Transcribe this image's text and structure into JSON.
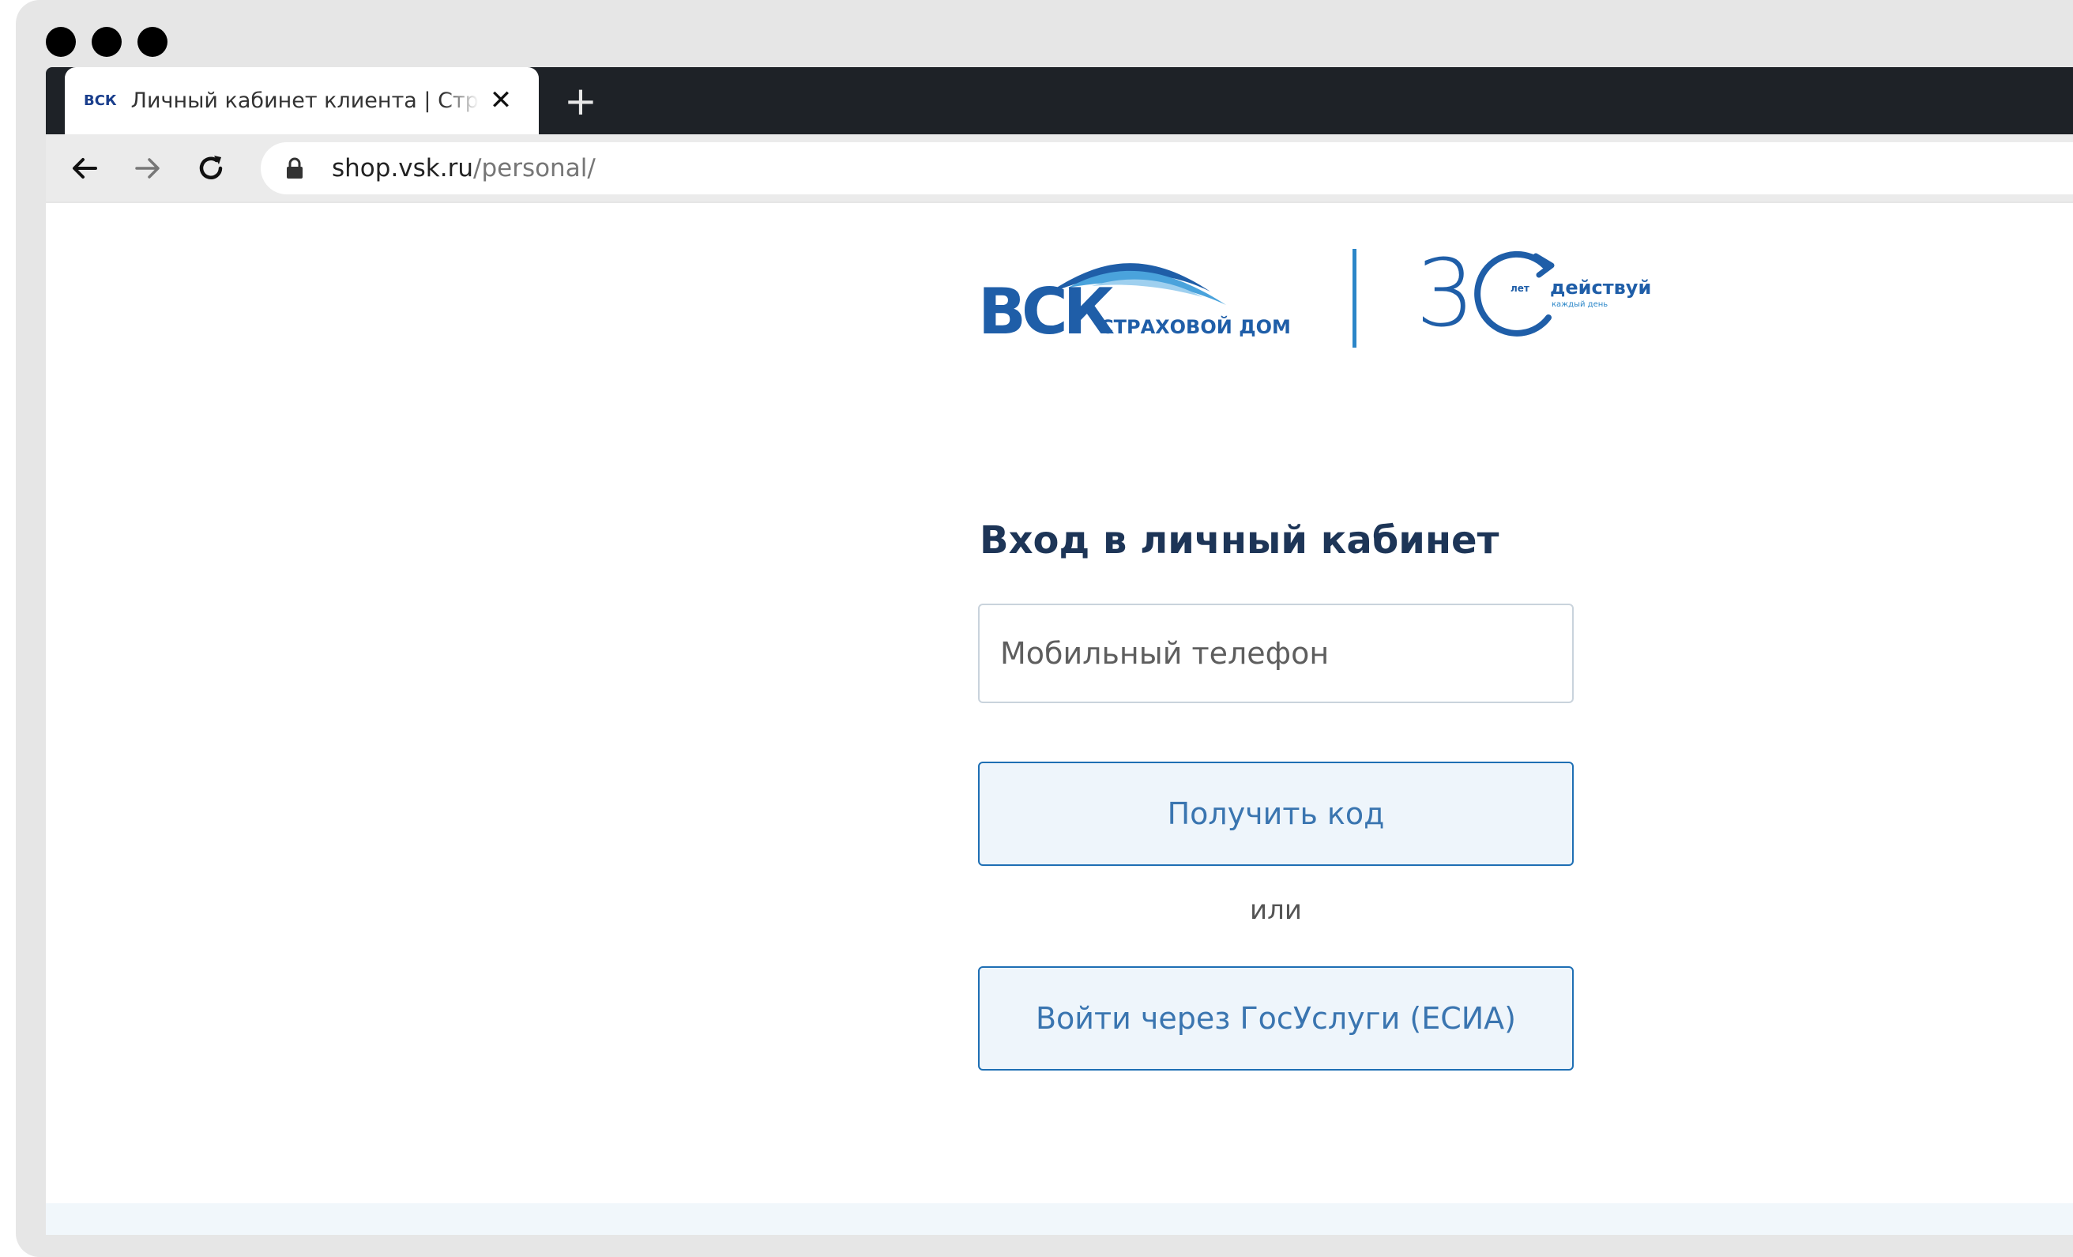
{
  "browser": {
    "tab": {
      "favicon_text": "ВСК",
      "title": "Личный кабинет клиента | Стра",
      "close_glyph": "✕"
    },
    "new_tab_glyph": "+",
    "address_bar": {
      "host": "shop.vsk.ru",
      "path": "/personal/"
    }
  },
  "logo": {
    "brand": "ВСК",
    "subtitle": "СТРАХОВОЙ ДОМ",
    "anniversary_number": "3",
    "anniversary_unit": "лет",
    "slogan": "действуй",
    "slogan_small": "каждый день"
  },
  "login": {
    "heading": "Вход в личный кабинет",
    "phone_placeholder": "Мобильный телефон",
    "get_code_label": "Получить код",
    "or_label": "или",
    "esia_label": "Войти через ГосУслуги (ЕСИА)"
  },
  "colors": {
    "brand_blue": "#1f5ea8",
    "button_border": "#1e6fb4",
    "button_fill": "#eef5fb",
    "heading": "#1d3557"
  }
}
